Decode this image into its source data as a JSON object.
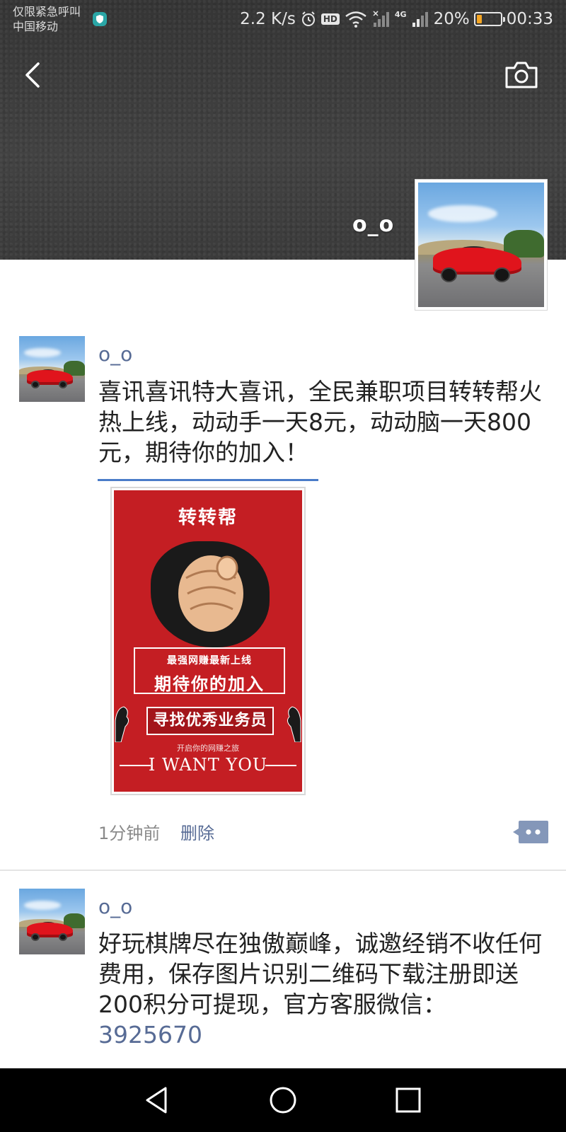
{
  "status_bar": {
    "carrier_line1": "仅限紧急呼叫",
    "carrier_line2": "中国移动",
    "net_speed": "2.2 K/s",
    "hd": "HD",
    "network": "4G",
    "battery_percent_label": "20%",
    "battery_level": 0.2,
    "time": "00:33",
    "battery_color": "#f5a623"
  },
  "header": {
    "back_icon": "chevron-left-icon",
    "camera_icon": "camera-icon",
    "username": "o_o"
  },
  "posts": [
    {
      "name": "o_o",
      "text": "喜讯喜讯特大喜讯，全民兼职项目转转帮火热上线，动动手一天8元，动动脑一天800元，期待你的加入！",
      "poster": {
        "title": "转转帮",
        "box_sub": "最强网赚最新上线",
        "box_main": "期待你的加入",
        "banner": "寻找优秀业务员",
        "small": "开启你的网赚之旅",
        "english": "I WANT YOU"
      },
      "time": "1分钟前",
      "delete_label": "删除"
    },
    {
      "name": "o_o",
      "text": "好玩棋牌尽在独傲巅峰，诚邀经销不收任何费用，保存图片识别二维码下载注册即送200积分可提现，官方客服微信：",
      "link": "3925670"
    }
  ],
  "colors": {
    "link": "#576b95",
    "cover": "#3a3a3a",
    "poster_red": "#c41e23"
  },
  "nav_icons": [
    "back-triangle-icon",
    "home-circle-icon",
    "recents-square-icon"
  ]
}
